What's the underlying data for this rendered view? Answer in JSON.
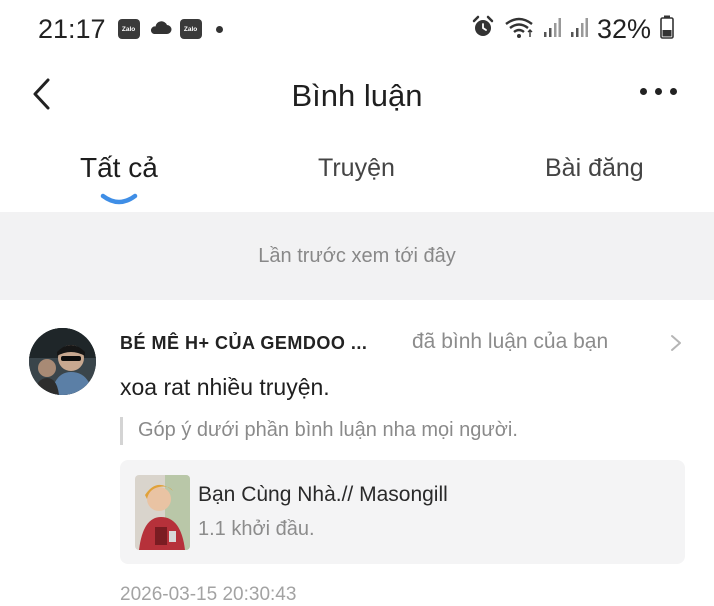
{
  "status_bar": {
    "time": "21:17",
    "notification_icons": [
      "zalo-icon",
      "cloud-icon",
      "zalo-icon"
    ],
    "zalo_label": "Zalo",
    "battery_percent": "32%",
    "system_icons": [
      "alarm-icon",
      "wifi-icon",
      "signal-icon",
      "signal-icon",
      "battery-icon"
    ]
  },
  "header": {
    "title": "Bình luận",
    "back_icon": "chevron-left-icon",
    "more_icon": "more-dots-icon"
  },
  "tabs": [
    {
      "label": "Tất cả",
      "active": true
    },
    {
      "label": "Truyện",
      "active": false
    },
    {
      "label": "Bài đăng",
      "active": false
    }
  ],
  "accent_color": "#3f8ee6",
  "notice": "Lần trước xem tới đây",
  "comment": {
    "author": "BÉ MÊ H+ CỦA GEMDOO ...",
    "action": "đã bình luận của bạn",
    "text": "xoa rat nhiều truyện.",
    "quote": "Góp ý dưới phần bình luận nha mọi người.",
    "story": {
      "title": "Bạn Cùng Nhà.// Masongill",
      "subtitle": "1.1 khởi đầu."
    },
    "timestamp": "2026-03-15 20:30:43"
  }
}
